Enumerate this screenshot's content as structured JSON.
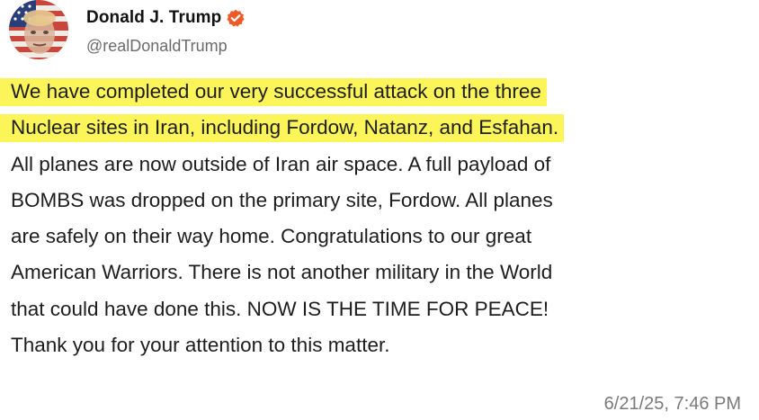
{
  "author": {
    "display_name": "Donald J. Trump",
    "handle": "@realDonaldTrump",
    "avatar_icon": "avatar-flag-portrait",
    "verified_icon": "verified-badge-icon",
    "verified_color": "#ef5a2b"
  },
  "post": {
    "highlight_color": "#fcf55a",
    "lines": [
      "We have completed our very successful attack on the three",
      "Nuclear sites in Iran, including Fordow, Natanz, and Esfahan.",
      "All planes are now outside of Iran air space. A full payload of",
      "BOMBS was dropped on the primary site, Fordow. All planes",
      "are safely on their way home. Congratulations to our great",
      "American Warriors. There is not another military in the World",
      "that could have done this. NOW IS THE TIME FOR PEACE!",
      "Thank you for your attention to this matter."
    ],
    "timestamp": "6/21/25, 7:46 PM"
  }
}
